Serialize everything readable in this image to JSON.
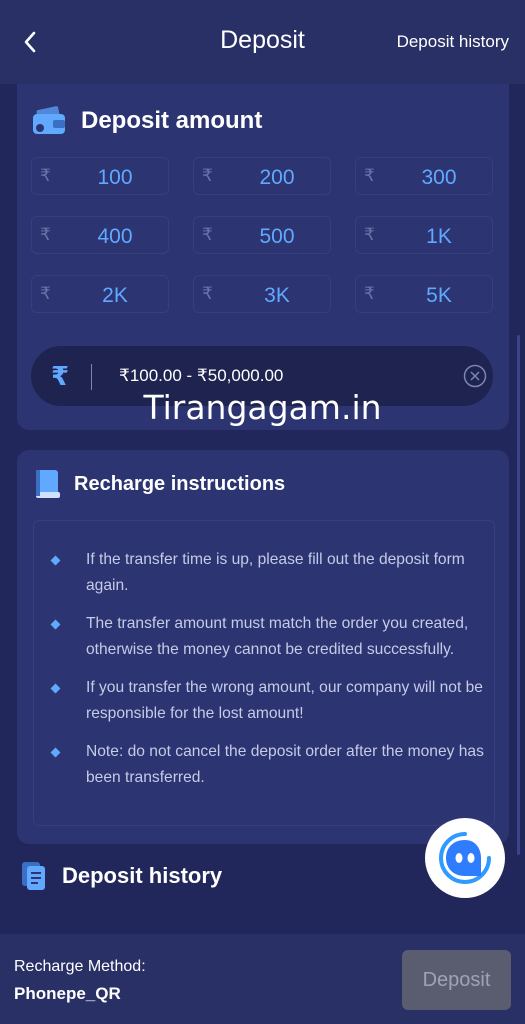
{
  "header": {
    "title": "Deposit",
    "history_link": "Deposit history"
  },
  "deposit_amount": {
    "title": "Deposit amount",
    "currency_symbol": "₹",
    "options": [
      "100",
      "200",
      "300",
      "400",
      "500",
      "1K",
      "2K",
      "3K",
      "5K"
    ],
    "input_placeholder": "₹100.00 - ₹50,000.00"
  },
  "watermark": "Tirangagam.in",
  "instructions": {
    "title": "Recharge instructions",
    "items": [
      "If the transfer time is up, please fill out the deposit form again.",
      "The transfer amount must match the order you created, otherwise the money cannot be credited successfully.",
      "If you transfer the wrong amount, our company will not be responsible for the lost amount!",
      "Note: do not cancel the deposit order after the money has been transferred."
    ]
  },
  "history": {
    "title": "Deposit history"
  },
  "footer": {
    "method_label": "Recharge Method:",
    "method_value": "Phonepe_QR",
    "deposit_button": "Deposit"
  },
  "colors": {
    "background": "#22275b",
    "card": "#2c3472",
    "accent": "#61a9ff",
    "deposit_button_disabled": "#5a5d70"
  },
  "icons": [
    "back-arrow-icon",
    "wallet-icon",
    "rupee-icon",
    "clear-icon",
    "book-icon",
    "document-icon",
    "chat-bot-icon"
  ]
}
